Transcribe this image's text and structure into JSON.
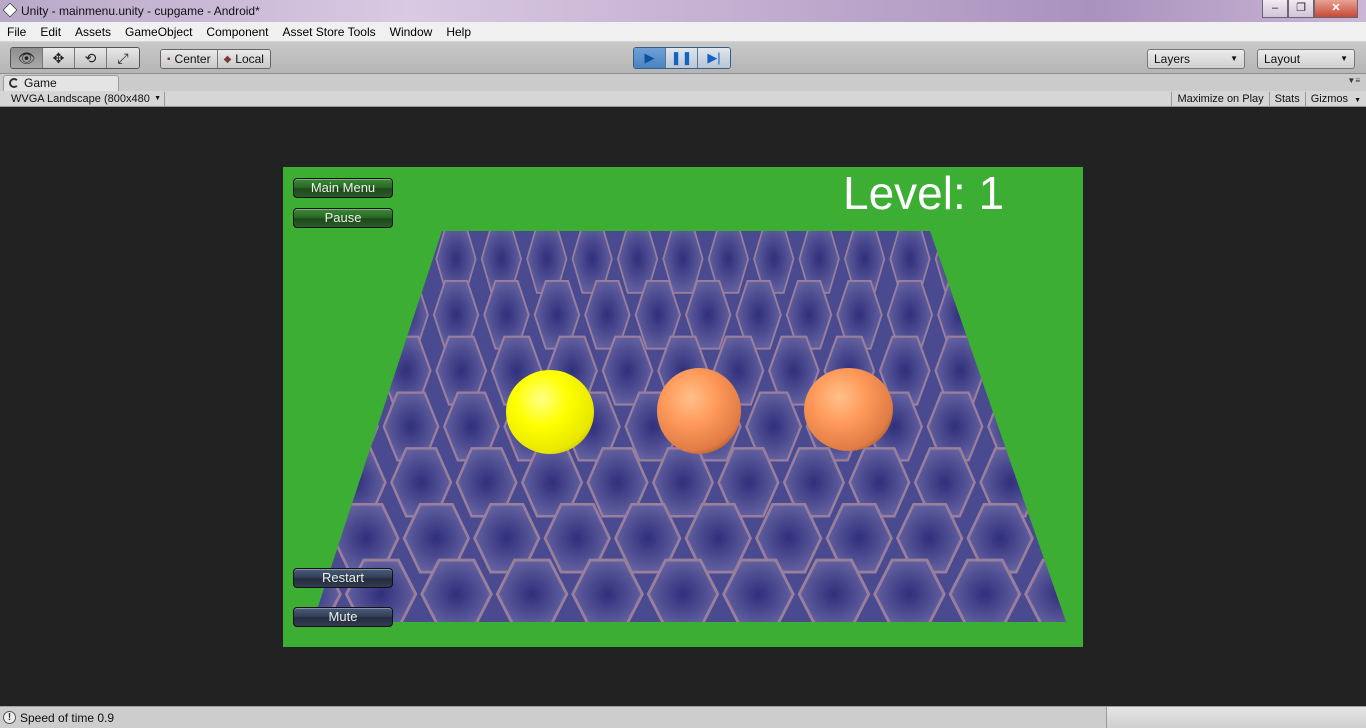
{
  "window": {
    "title": "Unity - mainmenu.unity - cupgame - Android*",
    "minimize": "‒",
    "maximize": "❐",
    "close": "✕"
  },
  "menu": [
    "File",
    "Edit",
    "Assets",
    "GameObject",
    "Component",
    "Asset Store Tools",
    "Window",
    "Help"
  ],
  "toolbar": {
    "tools": [
      {
        "name": "hand-tool",
        "icon": "eye-icon",
        "glyph": "👁"
      },
      {
        "name": "move-tool",
        "icon": "move-icon",
        "glyph": "✥"
      },
      {
        "name": "rotate-tool",
        "icon": "rotate-icon",
        "glyph": "⟲"
      },
      {
        "name": "scale-tool",
        "icon": "scale-icon",
        "glyph": "⤢"
      }
    ],
    "pivot_center": "Center",
    "pivot_local": "Local",
    "play_glyph": "▶",
    "pause_glyph": "❚❚",
    "step_glyph": "▶|",
    "layers": "Layers",
    "layout": "Layout"
  },
  "game_tab": {
    "label": "Game",
    "aspect": "WVGA Landscape (800x480",
    "maximize_on_play": "Maximize on Play",
    "stats": "Stats",
    "gizmos": "Gizmos"
  },
  "game": {
    "main_menu": "Main Menu",
    "pause": "Pause",
    "restart": "Restart",
    "mute": "Mute",
    "level": "Level: 1"
  },
  "status": {
    "text": "Speed of time 0.9"
  },
  "colors": {
    "game_background": "#3dae34",
    "board": "#45458f",
    "hex_lines": "#9a7f9c",
    "accent_play": "#4a83c2"
  }
}
